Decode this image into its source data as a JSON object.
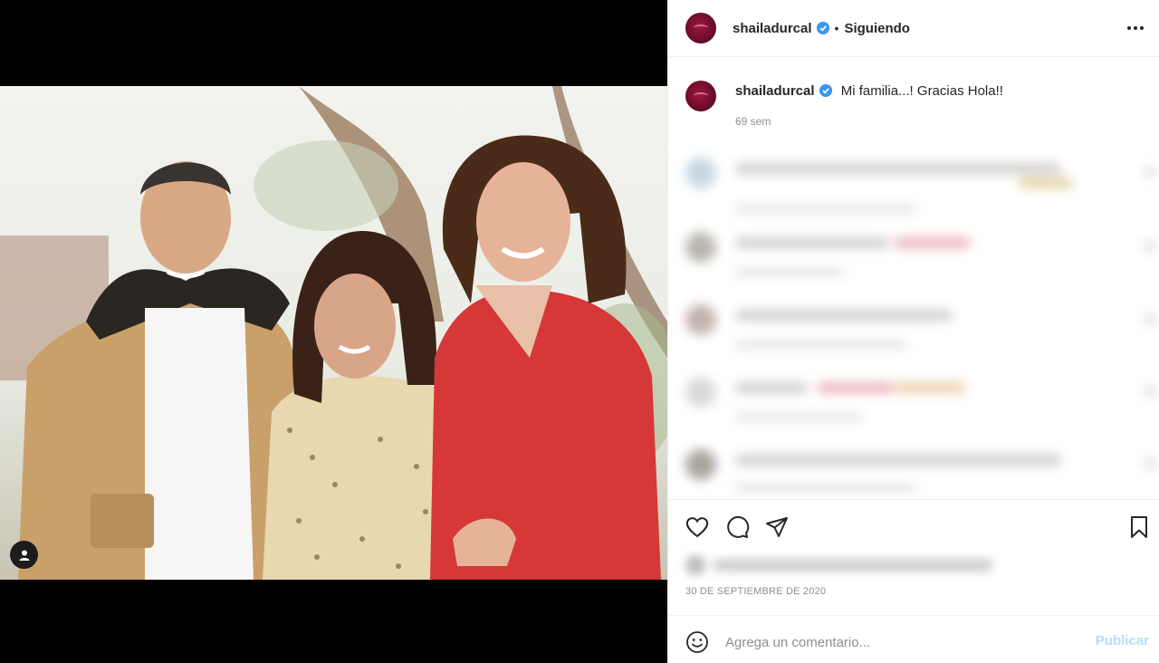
{
  "post": {
    "author": "shailadurcal",
    "separator": "•",
    "follow_state": "Siguiendo",
    "caption": "Mi familia...! Gracias Hola!!",
    "caption_time": "69 sem",
    "date": "30 DE SEPTIEMBRE DE 2020"
  },
  "comment_input": {
    "placeholder": "Agrega un comentario...",
    "publish_label": "Publicar"
  },
  "icons": {
    "verified": "verified-badge-icon",
    "more": "more-options-icon",
    "like": "heart-icon",
    "comment": "comment-bubble-icon",
    "share": "paper-plane-icon",
    "save": "bookmark-icon",
    "emoji": "smiley-icon",
    "tags": "user-tag-icon"
  },
  "colors": {
    "verified_blue": "#3897f0",
    "publish_disabled": "#b2dffc",
    "text": "#262626",
    "muted": "#8e8e8e"
  }
}
